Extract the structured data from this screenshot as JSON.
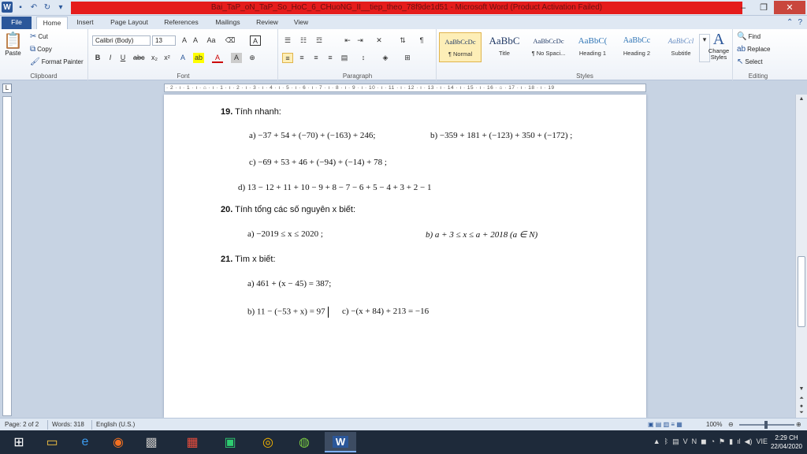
{
  "window": {
    "title": "Bai_TaP_oN_TaP_So_HoC_6_CHuoNG_II__tiep_theo_78f9de1d51 - Microsoft Word (Product Activation Failed)"
  },
  "tabs": [
    "File",
    "Home",
    "Insert",
    "Page Layout",
    "References",
    "Mailings",
    "Review",
    "View"
  ],
  "ribbon": {
    "clipboard": {
      "paste": "Paste",
      "cut": "Cut",
      "copy": "Copy",
      "format_painter": "Format Painter",
      "label": "Clipboard"
    },
    "font": {
      "name": "Calibri (Body)",
      "size": "13",
      "label": "Font"
    },
    "paragraph": {
      "label": "Paragraph"
    },
    "styles": {
      "label": "Styles",
      "items": [
        {
          "sample": "AaBbCcDc",
          "name": "¶ Normal"
        },
        {
          "sample": "AaBbC",
          "name": "Title"
        },
        {
          "sample": "AaBbCcDc",
          "name": "¶ No Spaci..."
        },
        {
          "sample": "AaBbC(",
          "name": "Heading 1"
        },
        {
          "sample": "AaBbCc",
          "name": "Heading 2"
        },
        {
          "sample": "AaBbCcl",
          "name": "Subtitle"
        }
      ],
      "change_styles": "Change Styles"
    },
    "editing": {
      "find": "Find",
      "replace": "Replace",
      "select": "Select",
      "label": "Editing"
    }
  },
  "ruler": {
    "text": "· 2 · ı · 1 · ı · ⌂ · ı · 1 · ı · 2 · ı · 3 · ı · 4 · ı · 5 · ı · 6 · ı · 7 · ı · 8 · ı · 9 · ı · 10 · ı · 11 · ı · 12 · ı · 13 · ı · 14 · ı · 15 · ı · 16 · ⌂ · 17 · ı · 18 · ı · 19"
  },
  "document": {
    "q19": {
      "num": "19.",
      "text": " Tính nhanh:"
    },
    "q19a": "a)  −37 + 54 + (−70) + (−163) + 246;",
    "q19b": "b)  −359 + 181 + (−123) + 350 + (−172) ;",
    "q19c": "c)  −69 + 53 + 46 + (−94) + (−14) + 78 ;",
    "q19d": "d)  13 − 12 + 11 + 10 − 9 + 8 − 7 − 6 + 5 − 4 + 3 + 2 − 1",
    "q20": {
      "num": "20.",
      "text": " Tính tổng các số nguyên x biết:"
    },
    "q20a": "a)  −2019 ≤ x ≤ 2020 ;",
    "q20b": "b)  a + 3 ≤ x ≤ a + 2018 (a ∈ N)",
    "q21": {
      "num": "21.",
      "text": " Tìm x biết:"
    },
    "q21a": "a)  461 + (x − 45) = 387;",
    "q21b": "b)  11 − (−53 + x) = 97",
    "q21c": "c)  −(x + 84) + 213 = −16"
  },
  "status": {
    "page": "Page: 2 of 2",
    "words": "Words: 318",
    "lang": "English (U.S.)",
    "zoom": "100%"
  },
  "taskbar": {
    "lang": "VIE",
    "time": "2:29 CH",
    "date": "22/04/2020"
  }
}
